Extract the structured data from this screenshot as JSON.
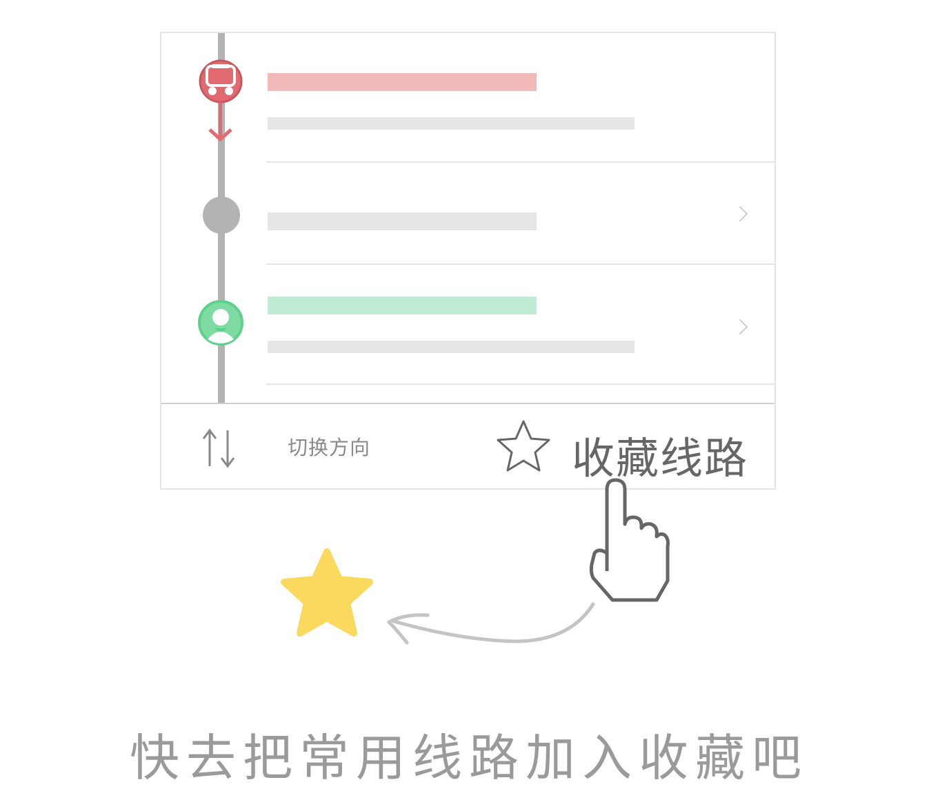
{
  "colors": {
    "bus_red": "#e06a70",
    "bus_bar": "#f2b9bb",
    "walk_green": "#5fd08c",
    "walk_bar": "#c0ecd3",
    "gray_stop": "#b3b3b3",
    "placeholder": "#e6e6e6",
    "star_fill": "#fbd85e"
  },
  "route_steps": [
    {
      "type": "bus",
      "icon": "bus-icon"
    },
    {
      "type": "stop",
      "icon": "stop-dot-icon"
    },
    {
      "type": "walk",
      "icon": "person-icon"
    }
  ],
  "bottom_bar": {
    "switch_label": "切换方向",
    "favorite_label": "收藏线路"
  },
  "caption": "快去把常用线路加入收藏吧"
}
